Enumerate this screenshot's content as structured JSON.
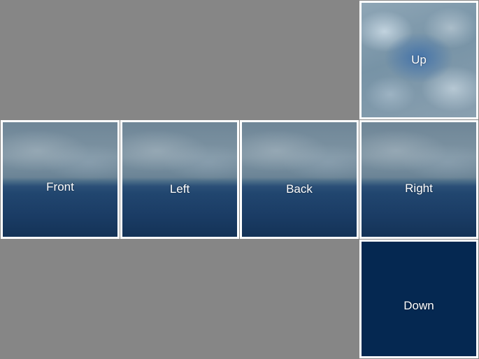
{
  "faces": {
    "up": {
      "label": "Up"
    },
    "front": {
      "label": "Front"
    },
    "left": {
      "label": "Left"
    },
    "back": {
      "label": "Back"
    },
    "right": {
      "label": "Right"
    },
    "down": {
      "label": "Down"
    }
  },
  "colors": {
    "background": "#868686",
    "border": "#ffffff",
    "sea": "#1b3d66",
    "down_face": "#052851",
    "label_text": "#ffffff"
  }
}
